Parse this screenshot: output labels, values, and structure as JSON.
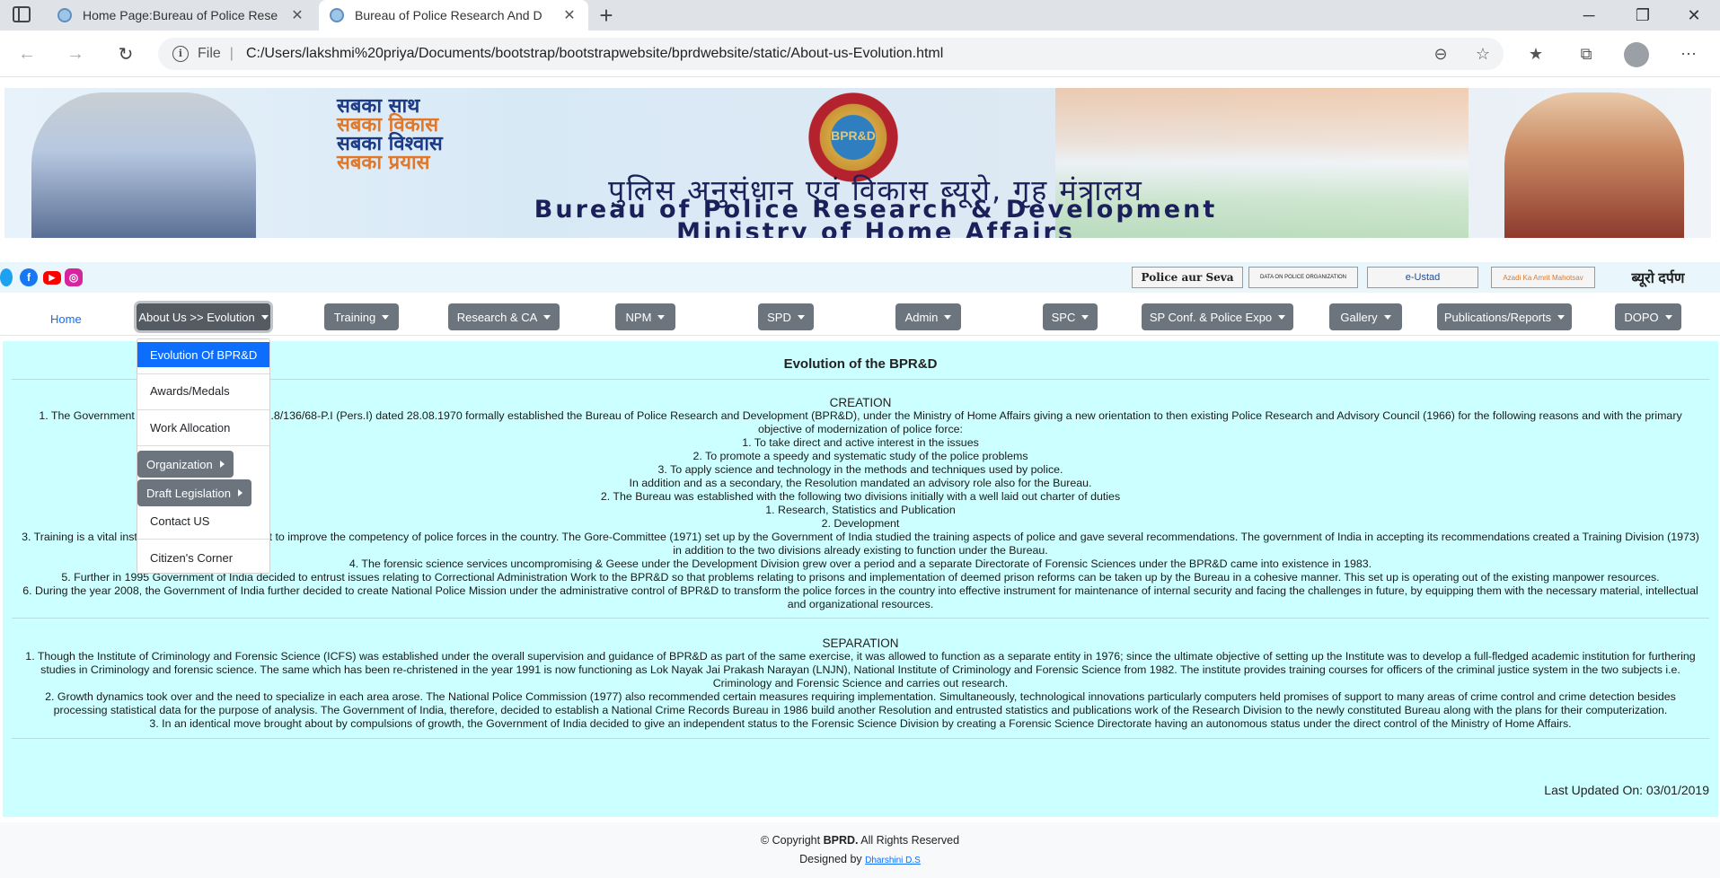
{
  "browser": {
    "tabs": [
      {
        "title": "Home Page:Bureau of Police Rese"
      },
      {
        "title": "Bureau of Police Research And D"
      }
    ],
    "new_tab_glyph": "+",
    "url_prefix": "File",
    "url": "C:/Users/lakshmi%20priya/Documents/bootstrap/bootstrapwebsite/bprdwebsite/static/About-us-Evolution.html"
  },
  "banner": {
    "slogan_lines": [
      "सबका साथ",
      "सबका विकास",
      "सबका विश्वास",
      "सबका प्रयास"
    ],
    "emblem_text": "BPR&D",
    "hindi_title": "पुलिस अनुसंधान एवं विकास ब्यूरो, गृह मंत्रालय",
    "english_title": "Bureau of Police Research & Development",
    "ministry": "Ministry of Home Affairs"
  },
  "partners": [
    "Police aur Seva",
    "DATA ON POLICE ORGANIZATION",
    "e-Ustad",
    "Azadi Ka Amrit Mahotsav",
    "ब्यूरो दर्पण"
  ],
  "nav": {
    "home": "Home",
    "menus": [
      "About Us >> Evolution",
      "Training",
      "Research & CA",
      "NPM",
      "SPD",
      "Admin",
      "SPC",
      "SP Conf. & Police Expo",
      "Gallery",
      "Publications/Reports",
      "DOPO"
    ]
  },
  "dropdown": {
    "items": [
      "Evolution Of BPR&D",
      "Awards/Medals",
      "Work Allocation",
      "Contact US",
      "Citizen's Corner"
    ],
    "submenus": [
      "Organization",
      "Draft Legislation"
    ]
  },
  "content": {
    "heading": "Evolution of the BPR&D",
    "creation_title": "CREATION",
    "creation_lines": [
      "1. The Government of India vide Resolution No.8/136/68-P.I (Pers.I) dated 28.08.1970 formally established the Bureau of Police Research and Development (BPR&D), under the Ministry of Home Affairs giving a new orientation to then existing Police Research and Advisory Council (1966) for the following reasons and with the primary objective of modernization of police force:",
      "1. To take direct and active interest in the issues",
      "2. To promote a speedy and systematic study of the police problems",
      "3. To apply science and technology in the methods and techniques used by police.",
      "In addition and as a secondary, the Resolution mandated an advisory role also for the Bureau.",
      "2. The Bureau was established with the following two divisions initially with a well laid out charter of duties",
      "1. Research, Statistics and Publication",
      "2. Development",
      "3. Training is a vital instrument and key component to improve the competency of police forces in the country. The Gore-Committee (1971) set up by the Government of India studied the training aspects of police and gave several recommendations. The government of India in accepting its recommendations created a Training Division (1973) in addition to the two divisions already existing to function under the Bureau.",
      "4. The forensic science services uncompromising & Geese under the Development Division grew over a period and a separate Directorate of Forensic Sciences under the BPR&D came into existence in 1983.",
      "5. Further in 1995 Government of India decided to entrust issues relating to Correctional Administration Work to the BPR&D so that problems relating to prisons and implementation of deemed prison reforms can be taken up by the Bureau in a cohesive manner. This set up is operating out of the existing manpower resources.",
      "6. During the year 2008, the Government of India further decided to create National Police Mission under the administrative control of BPR&D to transform the police forces in the country into effective instrument for maintenance of internal security and facing the challenges in future, by equipping them with the necessary material, intellectual and organizational resources."
    ],
    "separation_title": "SEPARATION",
    "separation_lines": [
      "1. Though the Institute of Criminology and Forensic Science (ICFS) was established under the overall supervision and guidance of BPR&D as part of the same exercise, it was allowed to function as a separate entity in 1976; since the ultimate objective of setting up the Institute was to develop a full-fledged academic institution for furthering studies in Criminology and forensic science. The same which has been re-christened in the year 1991 is now functioning as Lok Nayak Jai Prakash Narayan (LNJN), National Institute of Criminology and Forensic Science from 1982. The institute provides training courses for officers of the criminal justice system in the two subjects i.e. Criminology and Forensic Science and carries out research.",
      "2. Growth dynamics took over and the need to specialize in each area arose. The National Police Commission (1977) also recommended certain measures requiring implementation. Simultaneously, technological innovations particularly computers held promises of support to many areas of crime control and crime detection besides processing statistical data for the purpose of analysis. The Government of India, therefore, decided to establish a National Crime Records Bureau in 1986 build another Resolution and entrusted statistics and publications work of the Research Division to the newly constituted Bureau along with the plans for their computerization.",
      "3. In an identical move brought about by compulsions of growth, the Government of India decided to give an independent status to the Forensic Science Division by creating a Forensic Science Directorate having an autonomous status under the direct control of the Ministry of Home Affairs."
    ],
    "last_updated": "Last Updated On: 03/01/2019"
  },
  "footer": {
    "copyright_prefix": "© Copyright",
    "brand": "BPRD.",
    "rights": "All Rights Reserved",
    "designed_by": "Designed by",
    "designer": "Dharshini D.S"
  }
}
